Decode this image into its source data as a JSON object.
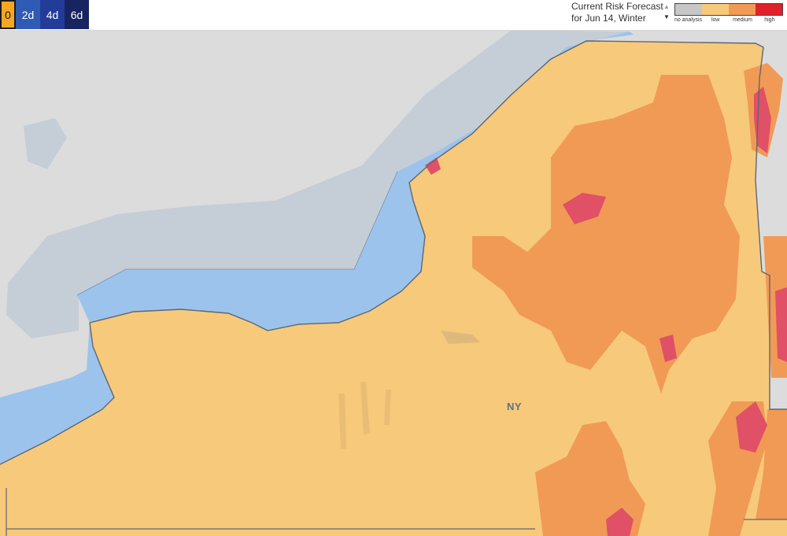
{
  "day_tabs": [
    {
      "label": "0",
      "color": "#f5a623",
      "active": true
    },
    {
      "label": "2d",
      "color": "#2f5bb4",
      "active": false
    },
    {
      "label": "4d",
      "color": "#233c9a",
      "active": false
    },
    {
      "label": "6d",
      "color": "#17245f",
      "active": false
    }
  ],
  "forecast": {
    "line1": "Current Risk Forecast",
    "line2": "for Jun 14, Winter"
  },
  "legend": {
    "items": [
      {
        "label": "no analysis",
        "color": "#c7c7c7"
      },
      {
        "label": "low",
        "color": "#f7c97a"
      },
      {
        "label": "medium",
        "color": "#f19a55"
      },
      {
        "label": "high",
        "color": "#e0202a"
      }
    ]
  },
  "map": {
    "state_label": "NY",
    "colors": {
      "land_gray": "#dcdcdc",
      "water_outside": "#c5cdd6",
      "water_lake": "#9cc3ec",
      "low": "#f7c97a",
      "medium": "#f19a55",
      "high": "#e05066",
      "border": "#5e6773"
    }
  }
}
